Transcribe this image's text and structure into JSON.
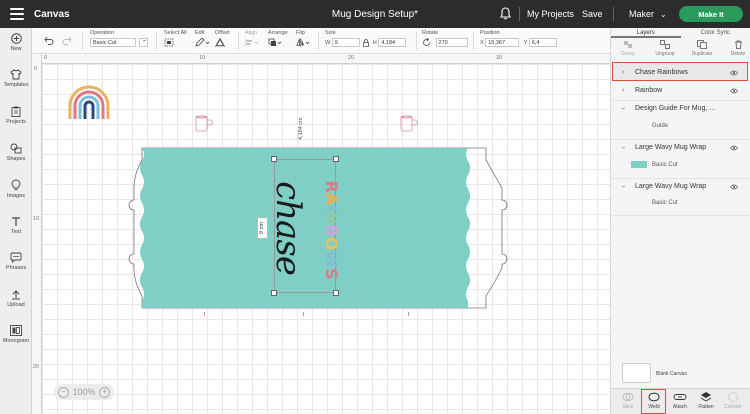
{
  "app": {
    "name": "Canvas",
    "document_title": "Mug Design Setup*",
    "my_projects": "My Projects",
    "save": "Save",
    "machine": "Maker",
    "make_it": "Make It"
  },
  "left_nav": [
    {
      "label": "New",
      "icon": "plus-circle-icon"
    },
    {
      "label": "Templates",
      "icon": "shirt-icon"
    },
    {
      "label": "Projects",
      "icon": "clipboard-icon"
    },
    {
      "label": "Shapes",
      "icon": "shapes-icon"
    },
    {
      "label": "Images",
      "icon": "lightbulb-icon"
    },
    {
      "label": "Text",
      "icon": "text-icon"
    },
    {
      "label": "Phrases",
      "icon": "speech-bubble-icon"
    },
    {
      "label": "Upload",
      "icon": "upload-icon"
    },
    {
      "label": "Monogram",
      "icon": "monogram-icon"
    }
  ],
  "toolbar": {
    "operation_label": "Operation",
    "operation_value": "Basic Cut",
    "select_all": "Select All",
    "edit": "Edit",
    "offset": "Offset",
    "align": "Align",
    "arrange": "Arrange",
    "flip": "Flip",
    "size_label": "Size",
    "w_label": "W",
    "w_value": "9",
    "h_label": "H",
    "h_value": "4,184",
    "rotate_label": "Rotate",
    "rotate_value": "270",
    "position_label": "Position",
    "x_label": "X",
    "x_value": "15,367",
    "y_label": "Y",
    "y_value": "6,4"
  },
  "canvas": {
    "ruler_top": [
      "0",
      "10",
      "20",
      "30"
    ],
    "ruler_left": [
      "0",
      "10",
      "20"
    ],
    "dim_height": "4,184 cm",
    "dim_width": "9 cm",
    "word_chase": "chase",
    "word_rainbows": "RAINBOWS",
    "rainbows_letters": [
      "R",
      "A",
      "I",
      "N",
      "B",
      "O",
      "W",
      "S"
    ],
    "rainbows_colors": [
      "#d97a86",
      "#e8b15a",
      "#7dbfd6",
      "#8fc9a0",
      "#c9a7d9",
      "#e8c15a",
      "#7dbfd6",
      "#d97a86"
    ],
    "mug_color": "#7fcfc7",
    "zoom_level": "100%",
    "zoom_minus": "−",
    "zoom_plus": "+"
  },
  "panel": {
    "tabs": [
      "Layers",
      "Color Sync"
    ],
    "actions": [
      "Group",
      "Ungroup",
      "Duplicate",
      "Delete"
    ],
    "layers": [
      {
        "name": "Chase Rainbows",
        "expanded": false,
        "selected": true
      },
      {
        "name": "Rainbow",
        "expanded": false
      },
      {
        "name": "Design Guide For Mug, ...",
        "expanded": true,
        "child": "Guide"
      },
      {
        "name": "Large Wavy Mug Wrap",
        "expanded": true,
        "child": "Basic Cut"
      },
      {
        "name": "Large Wavy Mug Wrap",
        "expanded": true,
        "child": "Basic Cut"
      }
    ],
    "blank_canvas": "Blank Canvas",
    "bottom": [
      "Slice",
      "Weld",
      "Attach",
      "Flatten",
      "Contour"
    ]
  }
}
